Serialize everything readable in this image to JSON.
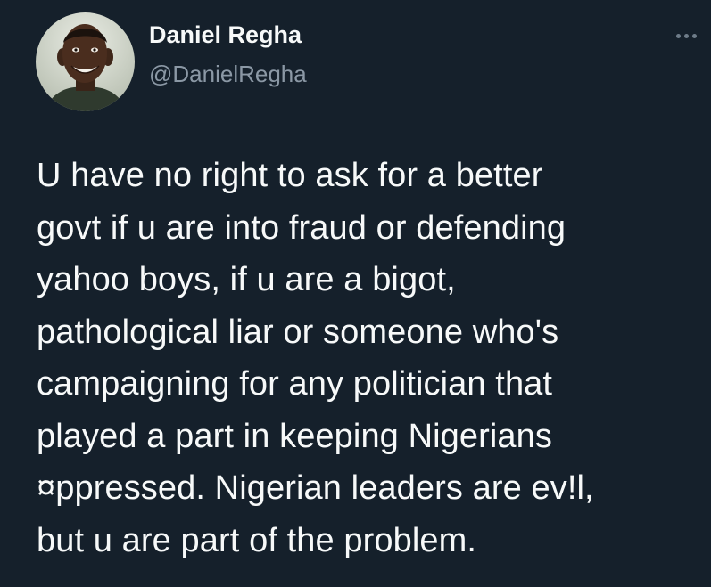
{
  "author": {
    "display_name": "Daniel Regha",
    "handle": "@DanielRegha",
    "avatar": "profile-photo"
  },
  "menu": {
    "icon": "more-horizontal-icon"
  },
  "tweet": {
    "text": "U have no right to ask for a better\ngovt if u are into fraud or defending\nyahoo boys, if u are a bigot,\npathological liar or someone who's\ncampaigning for any politician that\nplayed a part in keeping Nigerians\n¤ppressed. Nigerian leaders are ev!l,\nbut u are part of the problem."
  },
  "colors": {
    "background": "#15202b",
    "primary_text": "#f7f9f9",
    "secondary_text": "#8b98a5"
  }
}
